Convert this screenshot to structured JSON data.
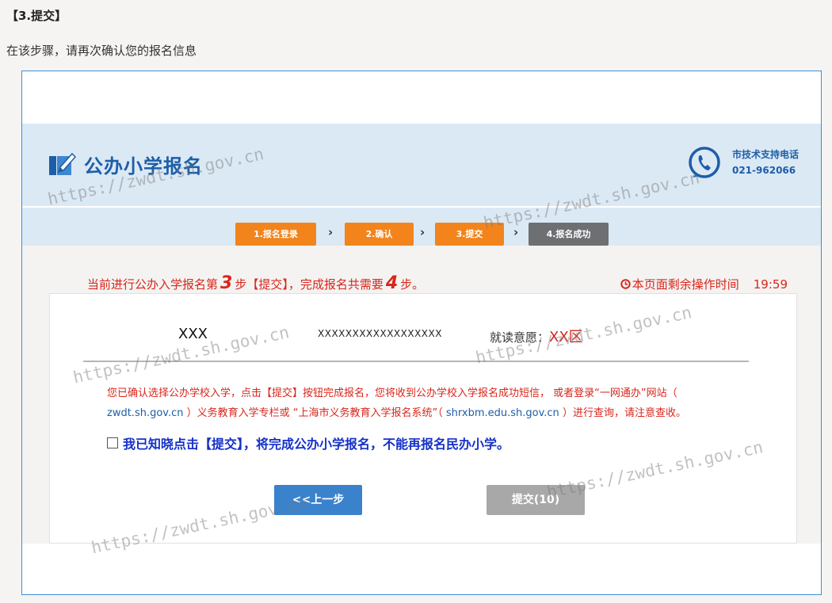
{
  "doc": {
    "heading": "【3.提交】",
    "intro": "在该步骤，请再次确认您的报名信息"
  },
  "site": {
    "title": "公办小学报名",
    "support_label": "市技术支持电话",
    "support_phone": "021-962066"
  },
  "steps": [
    {
      "label": "1.报名登录",
      "state": "done"
    },
    {
      "label": "2.确认",
      "state": "done"
    },
    {
      "label": "3.提交",
      "state": "current"
    },
    {
      "label": "4.报名成功",
      "state": "todo"
    }
  ],
  "step_arrow": "›",
  "progress": {
    "prefix": "当前进行公办入学报名第",
    "current_step": "3",
    "middle": "步【提交】，完成报名共需要",
    "total_steps": "4",
    "suffix": "步。"
  },
  "timer": {
    "label": "本页面剩余操作时间",
    "value": "19:59"
  },
  "applicant": {
    "name": "XXX",
    "id_number": "XXXXXXXXXXXXXXXXXX",
    "intent_label": "就读意愿：",
    "intent_value": "XX区"
  },
  "notice": {
    "part1": "您已确认选择公办学校入学，点击【提交】按钮完成报名，您将收到公办学校入学报名成功短信， 或者登录“一网通办”网站（ ",
    "link1": "zwdt.sh.gov.cn",
    "part2": " ）义务教育入学专栏或 “上海市义务教育入学报名系统”（ ",
    "link2": "shrxbm.edu.sh.gov.cn",
    "part3": " ）进行查询，请注意查收。"
  },
  "confirm_text": "我已知晓点击【提交】，将完成公办小学报名，不能再报名民办小学。",
  "buttons": {
    "prev": "<<上一步",
    "submit": "提交(10)"
  },
  "watermark": "https://zwdt.sh.gov.cn",
  "colors": {
    "brand_blue": "#1d5ea8",
    "step_done": "#f2841b",
    "step_todo": "#6d6f72",
    "alert_red": "#d9261c",
    "confirm_blue": "#1530c8"
  }
}
